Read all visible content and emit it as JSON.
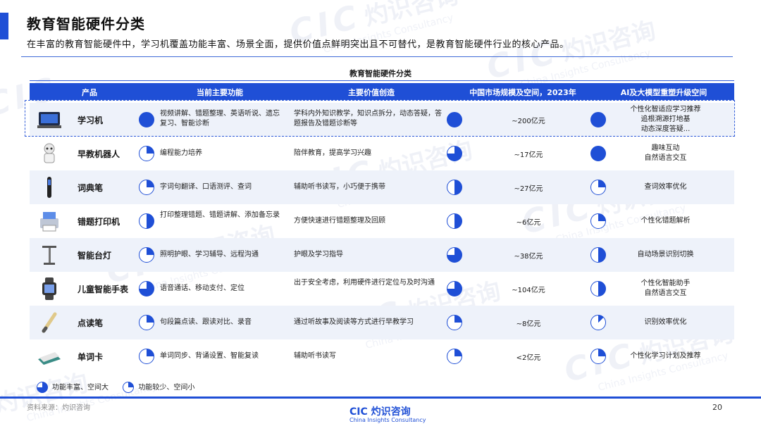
{
  "header": {
    "title": "教育智能硬件分类",
    "subtitle": "在丰富的教育智能硬件中，学习机覆盖功能丰富、场景全面，提供价值点鲜明突出且不可替代，是教育智能硬件行业的核心产品。"
  },
  "table": {
    "title": "教育智能硬件分类",
    "headers": [
      "产品",
      "当前主要功能",
      "主要价值创造",
      "中国市场规模及空间，2023年",
      "AI及大模型重塑升级空间"
    ],
    "rows": [
      {
        "name": "学习机",
        "icon": "tablet-icon",
        "func_fill": "full",
        "functions": "视频讲解、错题整理、英语听说、遗忘复习、智能诊断",
        "value": "学科内外知识教学，知识点拆分，动态答疑，答题报告及错题诊断等",
        "market_fill": "full",
        "market": "~200亿元",
        "ai_fill": "full",
        "ai": "个性化智适应学习推荐\n追根溯源打地基\n动态深度答疑..."
      },
      {
        "name": "早教机器人",
        "icon": "robot-icon",
        "func_fill": "quarter",
        "functions": "编程能力培养",
        "value": "陪伴教育，提高学习兴趣",
        "market_fill": "threeq",
        "market": "~17亿元",
        "ai_fill": "full",
        "ai": "趣味互动\n自然语言交互"
      },
      {
        "name": "词典笔",
        "icon": "pen-icon",
        "func_fill": "quarter",
        "functions": "字词句翻译、口语测评、查词",
        "value": "辅助听书读写，小巧便于携带",
        "market_fill": "half",
        "market": "~27亿元",
        "ai_fill": "quarter",
        "ai": "查词效率优化"
      },
      {
        "name": "错题打印机",
        "icon": "printer-icon",
        "func_fill": "half",
        "functions": "打印整理错题、错题讲解、添加备忘录",
        "value": "方便快速进行错题整理及回顾",
        "market_fill": "half",
        "market": "~6亿元",
        "ai_fill": "quarter",
        "ai": "个性化错题解析"
      },
      {
        "name": "智能台灯",
        "icon": "lamp-icon",
        "func_fill": "quarter",
        "functions": "照明护眼、学习辅导、远程沟通",
        "value": "护眼及学习指导",
        "market_fill": "threeq",
        "market": "~38亿元",
        "ai_fill": "half",
        "ai": "自动场景识别切换"
      },
      {
        "name": "儿童智能手表",
        "icon": "watch-icon",
        "func_fill": "threeq",
        "functions": "语音通话、移动支付、定位",
        "value": "出于安全考虑，利用硬件进行定位与及时沟通",
        "market_fill": "threeq",
        "market": "~104亿元",
        "ai_fill": "half",
        "ai": "个性化智能助手\n自然语言交互"
      },
      {
        "name": "点读笔",
        "icon": "reading-pen-icon",
        "func_fill": "quarter",
        "functions": "句段篇点读、跟读对比、录音",
        "value": "通过听故事及阅读等方式进行早教学习",
        "market_fill": "quarter",
        "market": "~8亿元",
        "ai_fill": "eighth",
        "ai": "识别效率优化"
      },
      {
        "name": "单词卡",
        "icon": "card-icon",
        "func_fill": "quarter",
        "functions": "单词同步、背诵设置、智能复读",
        "value": "辅助听书读写",
        "market_fill": "quarter",
        "market": "<2亿元",
        "ai_fill": "quarter",
        "ai": "个性化学习计划及推荐"
      }
    ]
  },
  "legend": {
    "full_label": "功能丰富、空间大",
    "partial_label": "功能较少、空间小"
  },
  "footer": {
    "source": "资料来源：灼识咨询",
    "logo_cn": "灼识咨询",
    "logo_en": "China Insights Consultancy",
    "page": "20"
  },
  "colors": {
    "accent": "#1f4fd6",
    "row_alt": "#eef2fa"
  }
}
